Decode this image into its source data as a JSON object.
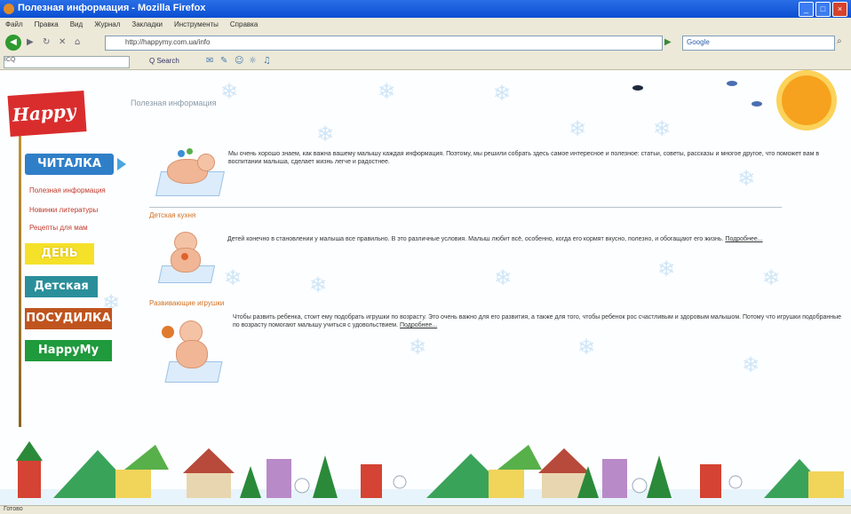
{
  "window": {
    "title": "Полезная информация - Mozilla Firefox",
    "controls": {
      "minimize": "_",
      "maximize": "□",
      "close": "×"
    }
  },
  "menubar": [
    "Файл",
    "Правка",
    "Вид",
    "Журнал",
    "Закладки",
    "Инструменты",
    "Справка"
  ],
  "navbar": {
    "back": "◀",
    "forward": "▶",
    "reload": "↻",
    "stop": "✕",
    "home": "⌂",
    "url": "http://happymy.com.ua/info",
    "search_engine": "Google",
    "go": "▶"
  },
  "bookmarks_bar": {
    "input": "ICQ",
    "search_label": "Q Search"
  },
  "sidebar": {
    "logo": "Happy",
    "buttons": [
      {
        "label": "ЧИТАЛКА"
      },
      {
        "label": "ДЕНЬ"
      },
      {
        "label": "Детская"
      },
      {
        "label": "ПОСУДИЛКА"
      },
      {
        "label": "HappyMy"
      }
    ],
    "sublinks": [
      "Полезная информация",
      "Новинки литературы",
      "Рецепты для мам"
    ]
  },
  "main": {
    "page_title": "Полезная информация",
    "intro_text": "Мы очень хорошо знаем, как важна вашему малышу каждая информация. Поэтому, мы решили собрать здесь самое интересное и полезное: статьи, советы, рассказы и многое другое, что поможет вам в воспитании малыша, сделает жизнь легче и радостнее.",
    "sections": [
      {
        "heading": "Детская кухня",
        "text": "Детей конечно в становлении у малыша все правильно. В это различные условия. Малыш любит всё, особенно, когда его кормят вкусно, полезно, и обогащают его жизнь.",
        "more": "Подробнее..."
      },
      {
        "heading": "Развивающие игрушки",
        "text": "Чтобы развить ребенка, стоит ему подобрать игрушки по возрасту. Это очень важно для его развития, а также для того, чтобы ребенок рос счастливым и здоровым малышом. Потому что игрушки подобранные по возрасту помогают малышу учиться с удовольствием.",
        "more": "Подробнее..."
      }
    ]
  },
  "status": {
    "text": "Готово"
  },
  "colors": {
    "titlebar": "#0a4ed3",
    "logo": "#d92d2d",
    "btn_read": "#2f7fc8",
    "btn_day": "#f5e12a",
    "btn_kids": "#2a8f9a",
    "btn_pos": "#c0541e",
    "btn_happy": "#1f9a3c",
    "section_heading": "#d2701f"
  }
}
